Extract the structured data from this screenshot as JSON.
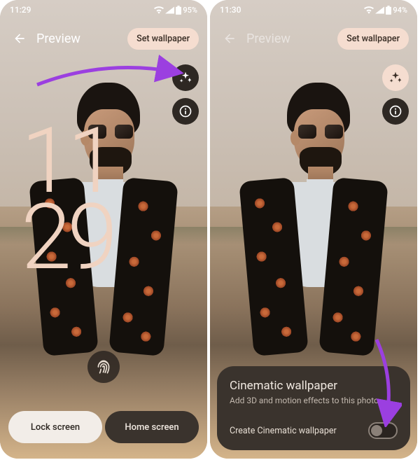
{
  "left": {
    "status": {
      "time": "11:29",
      "battery": "95%"
    },
    "header": {
      "title": "Preview",
      "set_label": "Set wallpaper"
    },
    "clock": {
      "hour": "11",
      "minute": "29"
    },
    "tabs": {
      "lock": "Lock screen",
      "home": "Home screen"
    }
  },
  "right": {
    "status": {
      "time": "11:30",
      "battery": "94%"
    },
    "header": {
      "title": "Preview",
      "set_label": "Set wallpaper"
    },
    "panel": {
      "title": "Cinematic wallpaper",
      "subtitle": "Add 3D and motion effects to this photo",
      "row_label": "Create Cinematic wallpaper"
    }
  },
  "icons": {
    "sparkle": "sparkle-icon",
    "info": "info-icon",
    "back": "back-arrow-icon",
    "wifi": "wifi-icon",
    "signal": "signal-icon",
    "battery": "battery-icon",
    "fingerprint": "fingerprint-icon"
  },
  "annotations": {
    "arrow_color": "#9b3fe0"
  }
}
